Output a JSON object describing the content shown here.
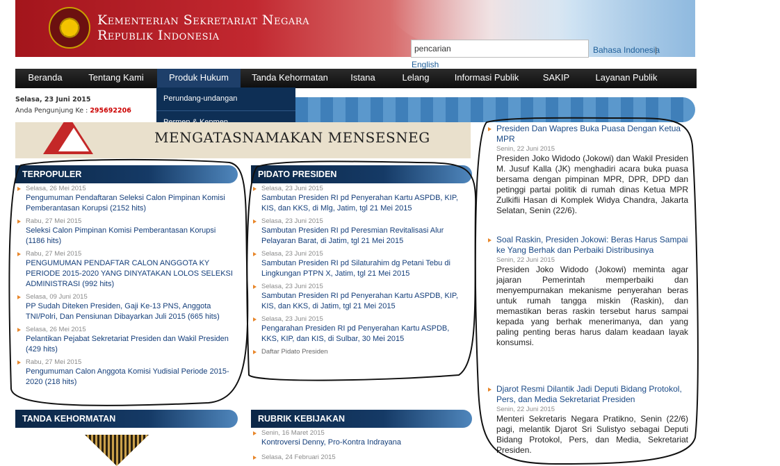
{
  "header": {
    "title_line1": "Kementerian Sekretariat Negara",
    "title_line2": "Republik Indonesia"
  },
  "search": {
    "value": "pencarian"
  },
  "lang": {
    "id": "Bahasa Indonesia",
    "sep": "|",
    "en": "English"
  },
  "nav": [
    "Beranda",
    "Tentang Kami",
    "Produk Hukum",
    "Tanda Kehormatan",
    "Istana",
    "Lelang",
    "Informasi Publik",
    "SAKIP",
    "Layanan Publik"
  ],
  "dropdown": [
    "Perundang-undangan",
    "Permen & Kepmen"
  ],
  "date": "Selasa, 23 Juni 2015",
  "visitor": {
    "label": "Anda Pengunjung Ke :",
    "count": "295692206"
  },
  "slider": {
    "text": "MENGATASNAMAKAN MENSESNEG"
  },
  "terpopuler": {
    "title": "TERPOPULER",
    "items": [
      {
        "date": "Selasa, 26 Mei 2015",
        "text": "Pengumuman Pendaftaran Seleksi Calon Pimpinan Komisi Pemberantasan Korupsi (2152 hits)"
      },
      {
        "date": "Rabu, 27 Mei 2015",
        "text": "Seleksi Calon Pimpinan Komisi Pemberantasan Korupsi (1186 hits)"
      },
      {
        "date": "Rabu, 27 Mei 2015",
        "text": "PENGUMUMAN PENDAFTAR CALON ANGGOTA KY PERIODE 2015-2020 YANG DINYATAKAN LOLOS SELEKSI ADMINISTRASI (992 hits)"
      },
      {
        "date": "Selasa, 09 Juni 2015",
        "text": "PP Sudah Diteken Presiden, Gaji Ke-13 PNS, Anggota TNI/Polri, Dan Pensiunan Dibayarkan Juli 2015 (665 hits)"
      },
      {
        "date": "Selasa, 26 Mei 2015",
        "text": "Pelantikan Pejabat Sekretariat Presiden dan Wakil Presiden (429 hits)"
      },
      {
        "date": "Rabu, 27 Mei 2015",
        "text": "Pengumuman Calon Anggota Komisi Yudisial Periode 2015-2020 (218 hits)"
      }
    ]
  },
  "pidato": {
    "title": "PIDATO PRESIDEN",
    "items": [
      {
        "date": "Selasa, 23 Juni 2015",
        "text": "Sambutan Presiden RI pd Penyerahan Kartu ASPDB, KIP, KIS, dan KKS, di Mlg, Jatim, tgl 21 Mei 2015"
      },
      {
        "date": "Selasa, 23 Juni 2015",
        "text": "Sambutan Presiden RI pd Peresmian Revitalisasi Alur Pelayaran Barat, di Jatim, tgl 21 Mei 2015"
      },
      {
        "date": "Selasa, 23 Juni 2015",
        "text": "Sambutan Presiden RI pd Silaturahim dg Petani Tebu di Lingkungan PTPN X, Jatim, tgl 21 Mei 2015"
      },
      {
        "date": "Selasa, 23 Juni 2015",
        "text": "Sambutan Presiden RI pd Penyerahan Kartu ASPDB, KIP, KIS, dan KKS, di Jatim, tgl 21 Mei 2015"
      },
      {
        "date": "Selasa, 23 Juni 2015",
        "text": "Pengarahan Presiden RI pd Penyerahan Kartu ASPDB, KKS, KIP, dan KIS, di Sulbar, 30 Mei 2015"
      }
    ],
    "more": "Daftar Pidato Presiden"
  },
  "tanda_kehormatan": {
    "title": "TANDA KEHORMATAN"
  },
  "rubrik": {
    "title": "RUBRIK KEBIJAKAN",
    "items": [
      {
        "date": "Senin, 16 Maret 2015",
        "text": "Kontroversi Denny, Pro-Kontra Indrayana"
      },
      {
        "date": "Selasa, 24 Februari 2015",
        "text": ""
      }
    ]
  },
  "news": [
    {
      "title": "Presiden Dan Wapres Buka Puasa Dengan Ketua MPR",
      "date": "Senin, 22 Juni 2015",
      "body": "Presiden Joko Widodo (Jokowi) dan Wakil Presiden M. Jusuf Kalla (JK) menghadiri acara buka puasa bersama dengan pimpinan MPR, DPR, DPD dan petinggi partai politik di rumah dinas Ketua MPR Zulkifli Hasan di Komplek Widya Chandra, Jakarta Selatan, Senin (22/6)."
    },
    {
      "title": "Soal Raskin, Presiden Jokowi: Beras Harus Sampai ke Yang Berhak dan Perbaiki Distribusinya",
      "date": "Senin, 22 Juni 2015",
      "body": "Presiden Joko Widodo (Jokowi) meminta agar jajaran Pemerintah memperbaiki dan menyempurnakan mekanisme penyerahan beras untuk rumah tangga miskin (Raskin), dan memastikan beras raskin tersebut harus sampai kepada yang berhak menerimanya, dan yang paling penting beras harus dalam keadaan layak konsumsi."
    },
    {
      "title": "Djarot Resmi Dilantik Jadi Deputi Bidang Protokol, Pers, dan Media Sekretariat Presiden",
      "date": "Senin, 22 Juni 2015",
      "body": "Menteri Sekretaris Negara Pratikno, Senin (22/6) pagi, melantik Djarot Sri Sulistyo sebagai Deputi Bidang Protokol, Pers, dan Media, Sekretariat Presiden."
    }
  ]
}
